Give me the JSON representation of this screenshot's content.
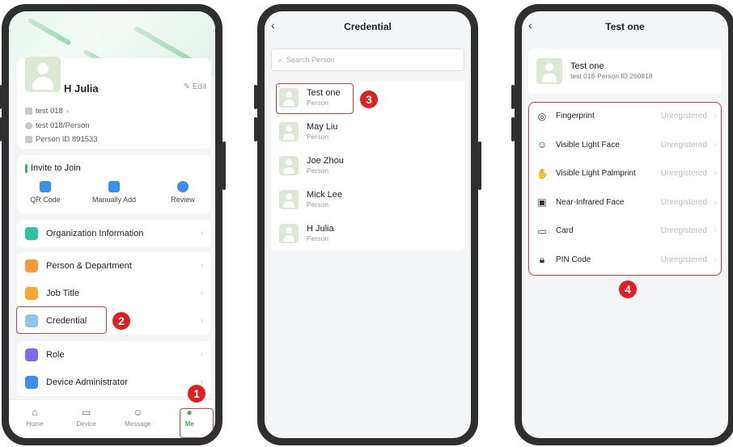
{
  "colors": {
    "accent": "#3cb45a",
    "annotation": "#e21f1f"
  },
  "phone1": {
    "profile": {
      "name": "H Julia",
      "edit_label": "Edit",
      "org": "test 018",
      "dept": "test 018/Person",
      "person_id": "Person ID 891533"
    },
    "invite": {
      "title": "Invite to Join",
      "actions": [
        {
          "label": "QR Code",
          "icon": "qr-code-icon"
        },
        {
          "label": "Manually Add",
          "icon": "manual-add-icon"
        },
        {
          "label": "Review",
          "icon": "review-icon"
        }
      ]
    },
    "menu": {
      "organization": "Organization Information",
      "person_department": "Person & Department",
      "job_title": "Job Title",
      "credential": "Credential",
      "role": "Role",
      "device_admin": "Device Administrator"
    },
    "tabs": [
      "Home",
      "Device",
      "Message",
      "Me"
    ],
    "callouts": {
      "one": "1",
      "two": "2"
    }
  },
  "phone2": {
    "title": "Credential",
    "search_placeholder": "Search Person",
    "persons": [
      {
        "name": "Test one",
        "type": "Person"
      },
      {
        "name": "May Liu",
        "type": "Person"
      },
      {
        "name": "Joe Zhou",
        "type": "Person"
      },
      {
        "name": "Mick Lee",
        "type": "Person"
      },
      {
        "name": "H Julia",
        "type": "Person"
      }
    ],
    "callout": "3"
  },
  "phone3": {
    "title": "Test one",
    "person_name": "Test one",
    "person_sub": "test 018·Person ID 260818",
    "credentials": [
      {
        "label": "Fingerprint",
        "status": "Unregistered"
      },
      {
        "label": "Visible Light Face",
        "status": "Unregistered"
      },
      {
        "label": "Visible Light Palmprint",
        "status": "Unregistered"
      },
      {
        "label": "Near-Infrared Face",
        "status": "Unregistered"
      },
      {
        "label": "Card",
        "status": "Unregistered"
      },
      {
        "label": "PIN Code",
        "status": "Unregistered"
      }
    ],
    "callout": "4"
  }
}
